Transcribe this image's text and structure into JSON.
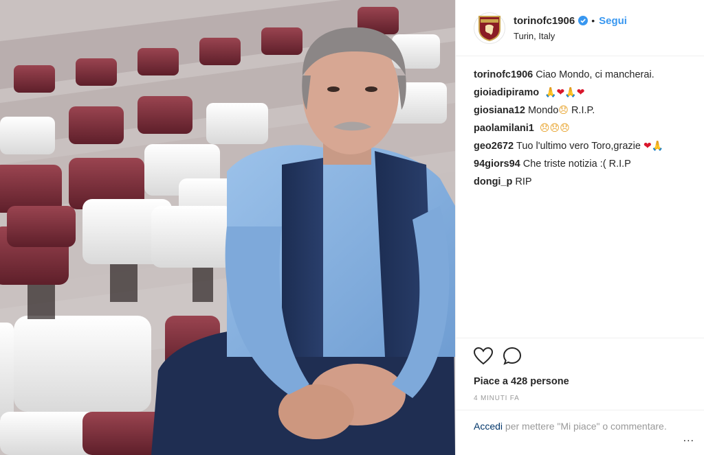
{
  "post": {
    "username": "torinofc1906",
    "follow_label": "Segui",
    "location": "Turin, Italy",
    "logo_text": "TORINO FC",
    "photo_description_icon": "photo"
  },
  "comments": [
    {
      "user": "torinofc1906",
      "text": "Ciao Mondo, ci mancherai."
    },
    {
      "user": "gioiadipiramo",
      "text": ""
    },
    {
      "user": "giosiana12",
      "text": "Mondo",
      "text2": "R.I.P."
    },
    {
      "user": "paolamilani1",
      "text": ""
    },
    {
      "user": "geo2672",
      "text": "Tuo l'ultimo vero Toro,grazie"
    },
    {
      "user": "94giors94",
      "text": "Che triste notizia :( R.I.P"
    },
    {
      "user": "dongi_p",
      "text": "RIP"
    }
  ],
  "actions": {
    "likes": "Piace a 428 persone",
    "time": "4 minuti fa"
  },
  "login": {
    "link": "Accedi",
    "text": "per mettere \"Mi piace\" o commentare.",
    "more": "..."
  },
  "colors": {
    "accent": "#3897f0",
    "heart": "#d9162b",
    "seat_maroon": "#7d2f3a"
  }
}
